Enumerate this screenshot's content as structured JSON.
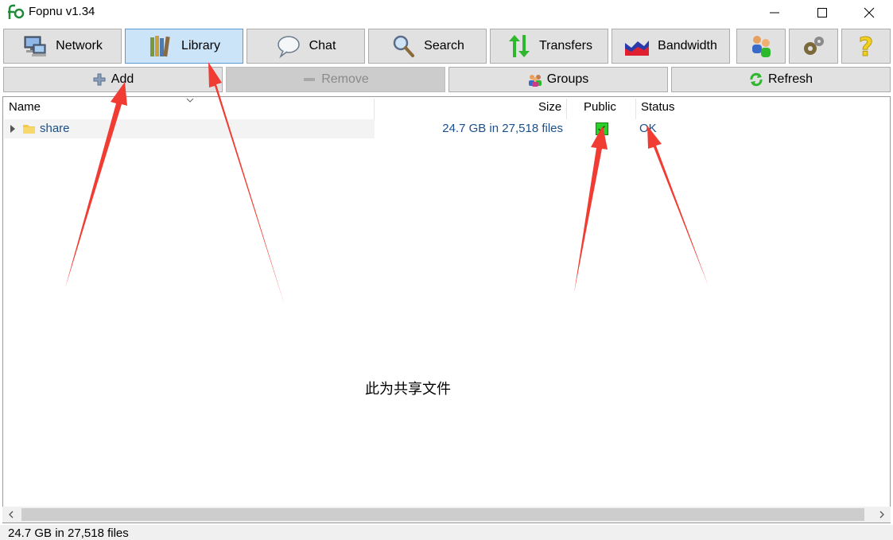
{
  "window": {
    "title": "Fopnu v1.34",
    "controls": [
      "minimize",
      "maximize",
      "close"
    ]
  },
  "toolbar": {
    "items": [
      {
        "label": "Network",
        "icon": "network-computer-icon",
        "active": false
      },
      {
        "label": "Library",
        "icon": "library-books-icon",
        "active": true
      },
      {
        "label": "Chat",
        "icon": "chat-bubble-icon",
        "active": false
      },
      {
        "label": "Search",
        "icon": "magnifier-icon",
        "active": false
      },
      {
        "label": "Transfers",
        "icon": "transfer-arrows-icon",
        "active": false
      },
      {
        "label": "Bandwidth",
        "icon": "bandwidth-graph-icon",
        "active": false
      }
    ],
    "icon_buttons": [
      "users-icon",
      "settings-gears-icon",
      "help-question-icon"
    ]
  },
  "actions": {
    "add": "Add",
    "remove": "Remove",
    "groups": "Groups",
    "refresh": "Refresh"
  },
  "columns": {
    "name": "Name",
    "size": "Size",
    "public": "Public",
    "status": "Status"
  },
  "rows": [
    {
      "name": "share",
      "size": "24.7 GB in 27,518 files",
      "public": true,
      "status": "OK"
    }
  ],
  "annotation": {
    "note": "此为共享文件",
    "arrow_color": "#f03c32"
  },
  "statusbar": {
    "text": "24.7 GB in 27,518 files"
  },
  "colors": {
    "active_tab": "#cce4f7",
    "link_blue": "#1b4f8b",
    "checkbox_green": "#2ad12a"
  }
}
